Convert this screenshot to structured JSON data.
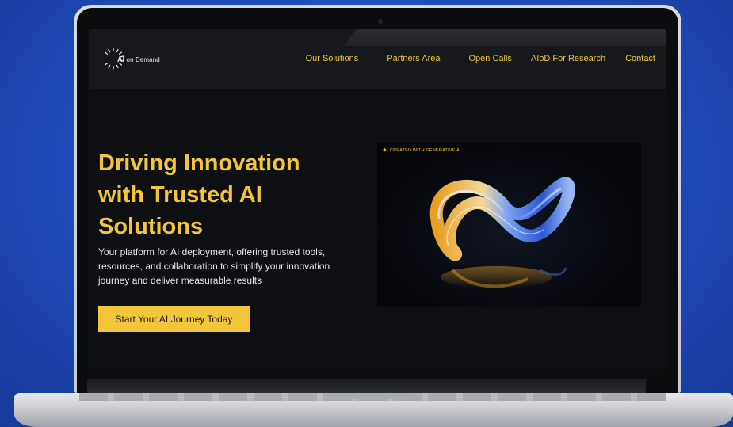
{
  "logo": {
    "ai": "AI",
    "text": "on Demand"
  },
  "nav": {
    "items": [
      {
        "label": "Our Solutions"
      },
      {
        "label": "Partners Area"
      },
      {
        "label": "Open Calls"
      },
      {
        "label": "AIoD For Research"
      },
      {
        "label": "Contact"
      }
    ]
  },
  "hero": {
    "title": "Driving Innovation with Trusted AI Solutions",
    "subtitle": "Your platform for AI deployment, offering trusted tools, resources, and collaboration to simplify your innovation journey and deliver measurable results",
    "cta_label": "Start Your AI Journey Today",
    "image_tag": "CREATED WITH GENERATIVE AI"
  },
  "colors": {
    "accent": "#f2c53a",
    "page_background": "#0d0f12",
    "nav_background": "#16181c",
    "backdrop": "#1f4fbf"
  },
  "icons": {
    "logo": "sunburst-logo-icon",
    "image_tag": "sparkle-icon"
  }
}
